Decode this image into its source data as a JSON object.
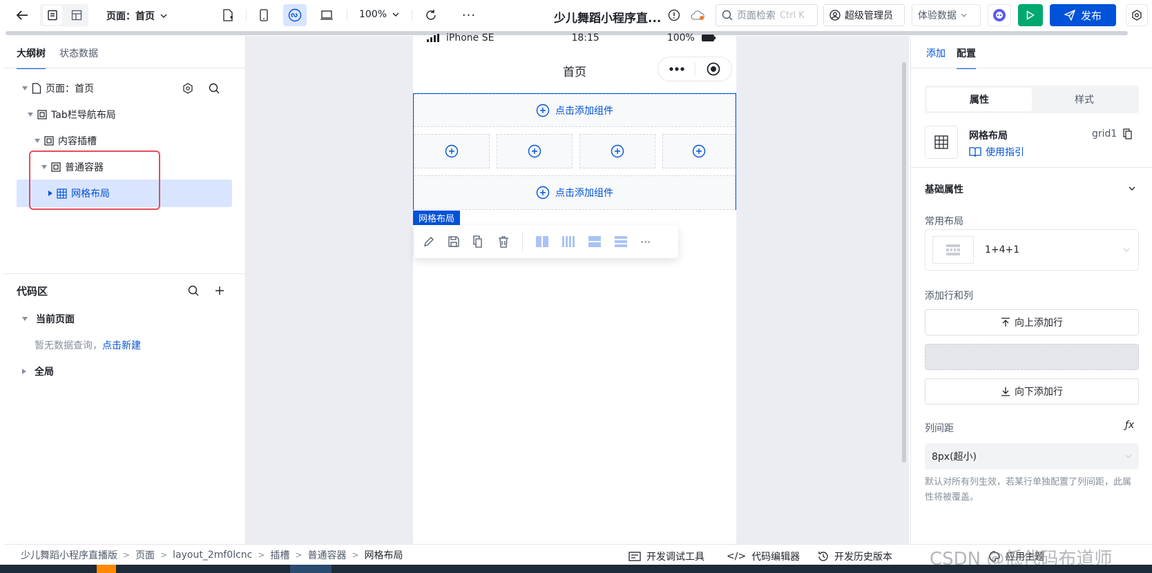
{
  "toolbar": {
    "page_selector": "页面：首页",
    "zoom": "100%",
    "app_title": "少儿舞蹈小程序直...",
    "search_placeholder": "页面检索",
    "search_shortcut": "Ctrl K",
    "user_role": "超级管理员",
    "data_mode": "体验数据",
    "publish": "发布"
  },
  "left_panel": {
    "tab_outline": "大纲树",
    "tab_state": "状态数据",
    "tree": [
      {
        "label": "页面：首页"
      },
      {
        "label": "Tab栏导航布局"
      },
      {
        "label": "内容插槽"
      },
      {
        "label": "普通容器"
      },
      {
        "label": "网格布局"
      }
    ]
  },
  "code_area": {
    "title": "代码区",
    "current_page": "当前页面",
    "empty_text": "暂无数据查询，",
    "create_link": "点击新建",
    "global": "全局"
  },
  "phone": {
    "device": "iPhone SE",
    "time": "18:15",
    "battery": "100%",
    "page_title": "首页",
    "add_component": "点击添加组件",
    "selected_label": "网格布局"
  },
  "right_panel": {
    "tab_add": "添加",
    "tab_config": "配置",
    "seg_props": "属性",
    "seg_style": "样式",
    "component_name": "网格布局",
    "component_id": "grid1",
    "guide_link": "使用指引",
    "section_basic": "基础属性",
    "common_layout_label": "常用布局",
    "common_layout_value": "1+4+1",
    "add_rowcol_label": "添加行和列",
    "add_row_above": "向上添加行",
    "add_row_below": "向下添加行",
    "col_gap_label": "列间距",
    "col_gap_value": "8px(超小)",
    "col_gap_hint": "默认对所有列生效，若某行单独配置了列间距，此属性将被覆盖。"
  },
  "breadcrumb": [
    "少儿舞蹈小程序直播版",
    "页面",
    "layout_2mf0lcnc",
    "插槽",
    "普通容器",
    "网格布局"
  ],
  "bottom_actions": {
    "dev_tools": "开发调试工具",
    "code_editor": "代码编辑器",
    "history": "开发历史版本",
    "theme": "应用主题"
  },
  "watermark": "CSDN @低代码布道师",
  "colors": {
    "accent": "#0052d9",
    "highlight_box": "#e34d59",
    "selected_bg": "#d9e5ff",
    "publish_bg": "#0052d9",
    "run_bg": "#00a870"
  }
}
